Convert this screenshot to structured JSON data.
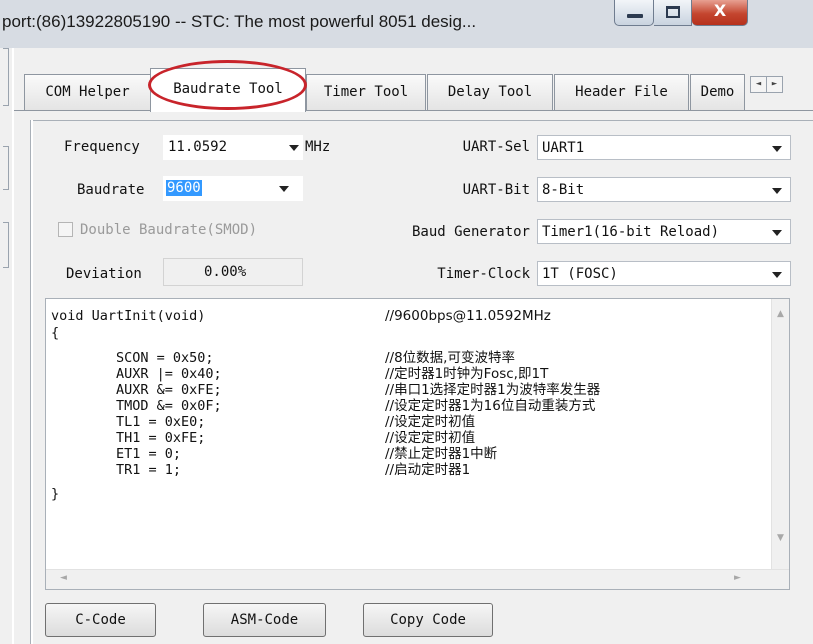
{
  "window": {
    "title": "port:(86)13922805190  -- STC: The most powerful 8051 desig...",
    "minimize_label": "",
    "maximize_label": "",
    "close_label": "X"
  },
  "tabs": [
    {
      "label": "COM Helper",
      "active": false
    },
    {
      "label": "Baudrate Tool",
      "active": true
    },
    {
      "label": "Timer Tool",
      "active": false
    },
    {
      "label": "Delay Tool",
      "active": false
    },
    {
      "label": "Header File",
      "active": false
    },
    {
      "label": "Demo",
      "active": false
    }
  ],
  "tab_scroll": {
    "left": "◄",
    "right": "►"
  },
  "form": {
    "frequency_label": "Frequency",
    "frequency_value": "11.0592",
    "frequency_unit": "MHz",
    "baudrate_label": "Baudrate",
    "baudrate_value": "9600",
    "double_baudrate_label": "Double Baudrate(SMOD)",
    "double_baudrate_checked": false,
    "deviation_label": "Deviation",
    "deviation_value": "0.00%",
    "uart_sel_label": "UART-Sel",
    "uart_sel_value": "UART1",
    "uart_bit_label": "UART-Bit",
    "uart_bit_value": "8-Bit",
    "baud_generator_label": "Baud Generator",
    "baud_generator_value": "Timer1(16-bit Reload)",
    "timer_clock_label": "Timer-Clock",
    "timer_clock_value": "1T   (FOSC)"
  },
  "code": {
    "lines": [
      {
        "code": "void UartInit(void)",
        "comment": "//9600bps@11.0592MHz"
      },
      {
        "code": "{",
        "comment": ""
      },
      {
        "code": "        SCON = 0x50;",
        "comment": "//8位数据,可变波特率"
      },
      {
        "code": "        AUXR |= 0x40;",
        "comment": "//定时器1时钟为Fosc,即1T"
      },
      {
        "code": "        AUXR &= 0xFE;",
        "comment": "//串口1选择定时器1为波特率发生器"
      },
      {
        "code": "        TMOD &= 0x0F;",
        "comment": "//设定定时器1为16位自动重装方式"
      },
      {
        "code": "        TL1 = 0xE0;",
        "comment": "//设定定时初值"
      },
      {
        "code": "        TH1 = 0xFE;",
        "comment": "//设定定时初值"
      },
      {
        "code": "        ET1 = 0;",
        "comment": "//禁止定时器1中断"
      },
      {
        "code": "        TR1 = 1;",
        "comment": "//启动定时器1"
      },
      {
        "code": "}",
        "comment": ""
      }
    ]
  },
  "buttons": {
    "c_code": "C-Code",
    "asm_code": "ASM-Code",
    "copy_code": "Copy Code"
  },
  "colors": {
    "highlight_oval": "#c8242b",
    "selection": "#3399ff",
    "close_button": "#c4462f"
  }
}
